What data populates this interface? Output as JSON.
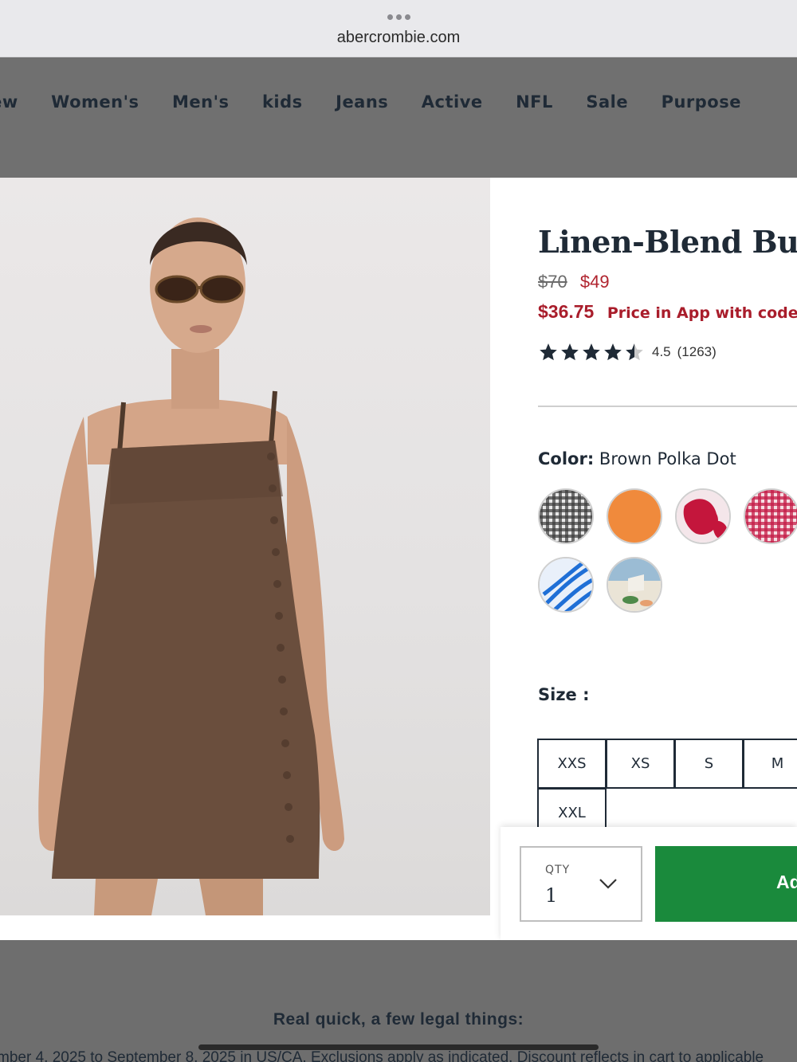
{
  "browser": {
    "url": "abercrombie.com",
    "menu_icon": "ellipsis-icon"
  },
  "nav": {
    "items": [
      "New",
      "Women's",
      "Men's",
      "kids",
      "Jeans",
      "Active",
      "NFL",
      "Sale",
      "Purpose"
    ]
  },
  "product": {
    "image_icon": "product-photo-model-in-brown-mini-dress",
    "title": "Linen-Blend Button",
    "price_original": "$70",
    "price_sale": "$49",
    "app_price": "$36.75",
    "app_price_note": "Price in App with code",
    "rating": 4.5,
    "rating_value": "4.5",
    "review_count": "(1263)",
    "color_label": "Color:",
    "color_selected": "Brown Polka Dot",
    "swatches": [
      {
        "name": "black gingham",
        "color": "#2a2a2a"
      },
      {
        "name": "orange",
        "color": "#f08a3c"
      },
      {
        "name": "red floral",
        "color": "#c4163c"
      },
      {
        "name": "red gingham",
        "color": "#c41c46"
      },
      {
        "name": "blue palm",
        "color": "#1f6fd6"
      },
      {
        "name": "scenic print",
        "color": "#9bbcd4"
      }
    ],
    "size_label": "Size :",
    "sizes": [
      "XXS",
      "XS",
      "S",
      "M",
      "XXL"
    ]
  },
  "purchase": {
    "qty_label": "QTY",
    "qty_value": "1",
    "add_label": "Add to Bag"
  },
  "footer": {
    "heading": "Real quick, a few legal things:",
    "legal_text": "mber 4, 2025 to September 8, 2025 in US/CA. Exclusions apply as indicated. Discount reflects in cart to applicable"
  },
  "colors": {
    "overlay_dim": "#707070",
    "sale_red": "#b0242f",
    "add_green": "#1a8a3c",
    "text_navy": "#1f2a36"
  }
}
